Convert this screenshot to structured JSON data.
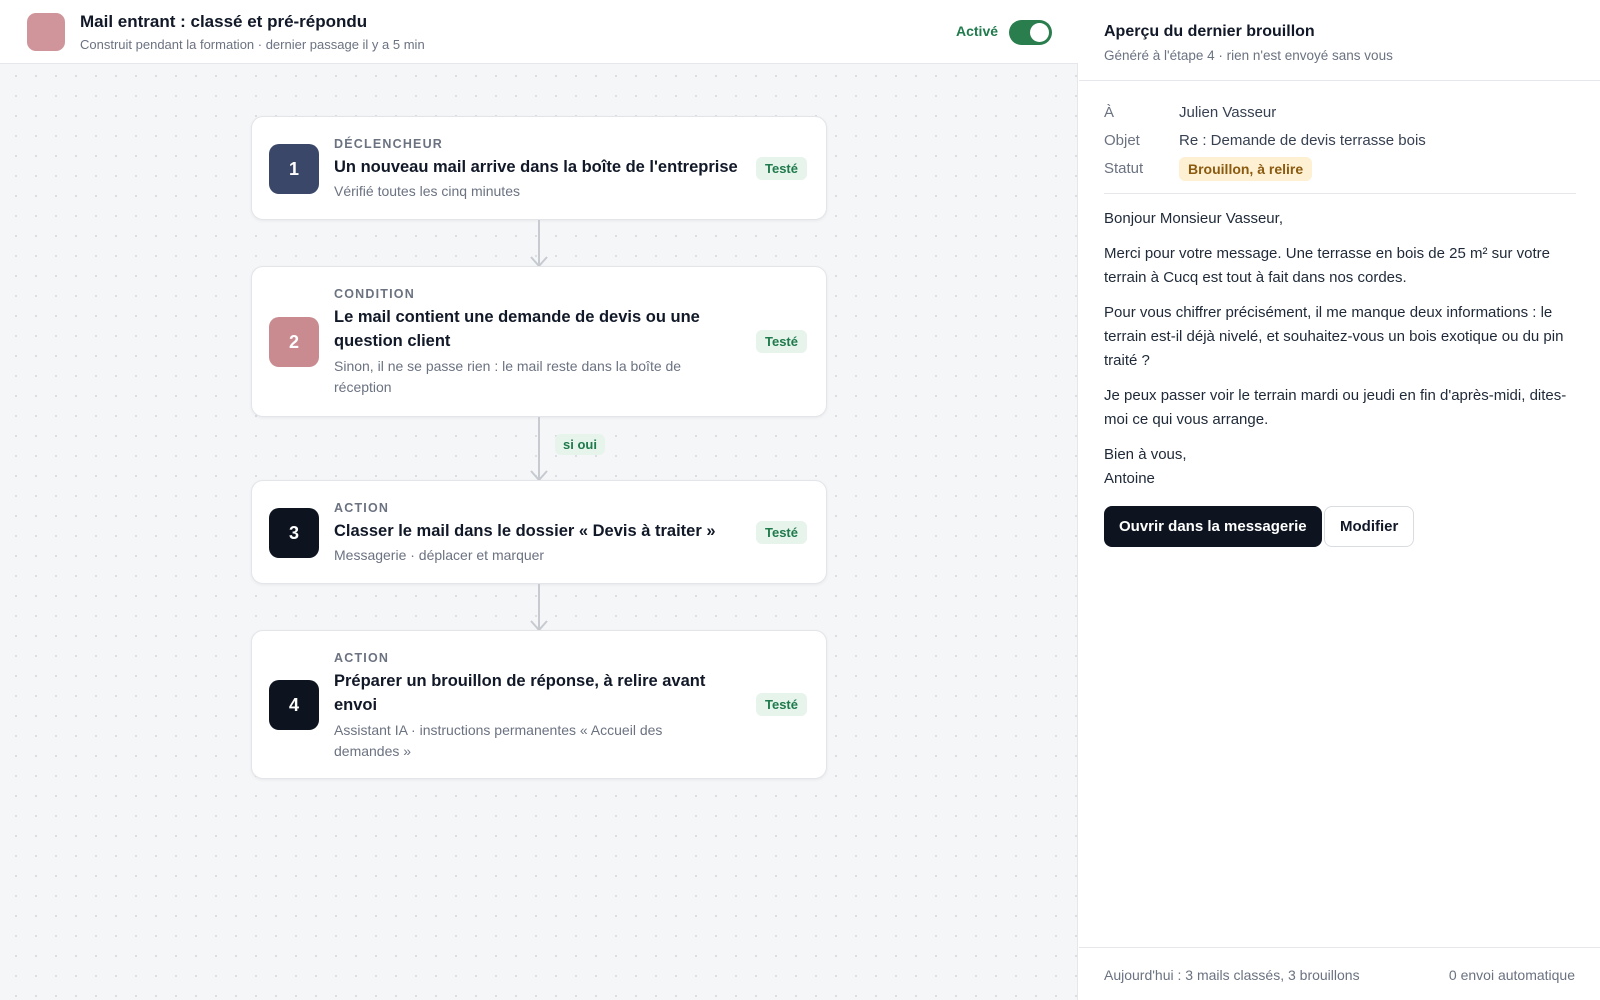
{
  "colors": {
    "app_icon": "#cf959a",
    "active_green": "#2a7d4d",
    "step_1": "#3a4768",
    "step_2": "#c98b90",
    "step_3": "#0d1420",
    "step_4": "#0d1420",
    "tested_badge_bg": "#e7f4ec",
    "draft_badge_bg": "#fdf0d3",
    "primary_button": "#0d1420"
  },
  "header": {
    "title": "Mail entrant : classé et pré-répondu",
    "subtitle": "Construit pendant la formation · dernier passage il y a 5 min",
    "active_label": "Activé",
    "active": true
  },
  "steps": [
    {
      "number": "1",
      "kind": "DÉCLENCHEUR",
      "title": "Un nouveau mail arrive dans la boîte de l'entreprise",
      "description": "Vérifié toutes les cinq minutes",
      "status": "Testé"
    },
    {
      "number": "2",
      "kind": "CONDITION",
      "title": "Le mail contient une demande de devis ou une question client",
      "description": "Sinon, il ne se passe rien : le mail reste dans la boîte de réception",
      "status": "Testé"
    },
    {
      "number": "3",
      "kind": "ACTION",
      "title": "Classer le mail dans le dossier « Devis à traiter »",
      "description": "Messagerie · déplacer et marquer",
      "status": "Testé"
    },
    {
      "number": "4",
      "kind": "ACTION",
      "title": "Préparer un brouillon de réponse, à relire avant envoi",
      "description": "Assistant IA · instructions permanentes « Accueil des demandes »",
      "status": "Testé"
    }
  ],
  "branch_label": "si oui",
  "preview": {
    "title": "Aperçu du dernier brouillon",
    "subtitle": "Généré à l'étape 4 · rien n'est envoyé sans vous",
    "to_label": "À",
    "to_value": "Julien Vasseur",
    "subject_label": "Objet",
    "subject_value": "Re : Demande de devis terrasse bois",
    "status_label": "Statut",
    "status_value": "Brouillon, à relire",
    "greeting": "Bonjour Monsieur Vasseur,",
    "paragraph_1": "Merci pour votre message. Une terrasse en bois de 25 m² sur votre terrain à Cucq est tout à fait dans nos cordes.",
    "paragraph_2": "Pour vous chiffrer précisément, il me manque deux informations : le terrain est-il déjà nivelé, et souhaitez-vous un bois exotique ou du pin traité ?",
    "paragraph_3": "Je peux passer voir le terrain mardi ou jeudi en fin d'après-midi, dites-moi ce qui vous arrange.",
    "closing": "Bien à vous,",
    "signature": "Antoine",
    "open_button": "Ouvrir dans la messagerie",
    "edit_button": "Modifier"
  },
  "footer": {
    "today_summary": "Aujourd'hui : 3 mails classés, 3 brouillons",
    "auto_send": "0 envoi automatique"
  }
}
